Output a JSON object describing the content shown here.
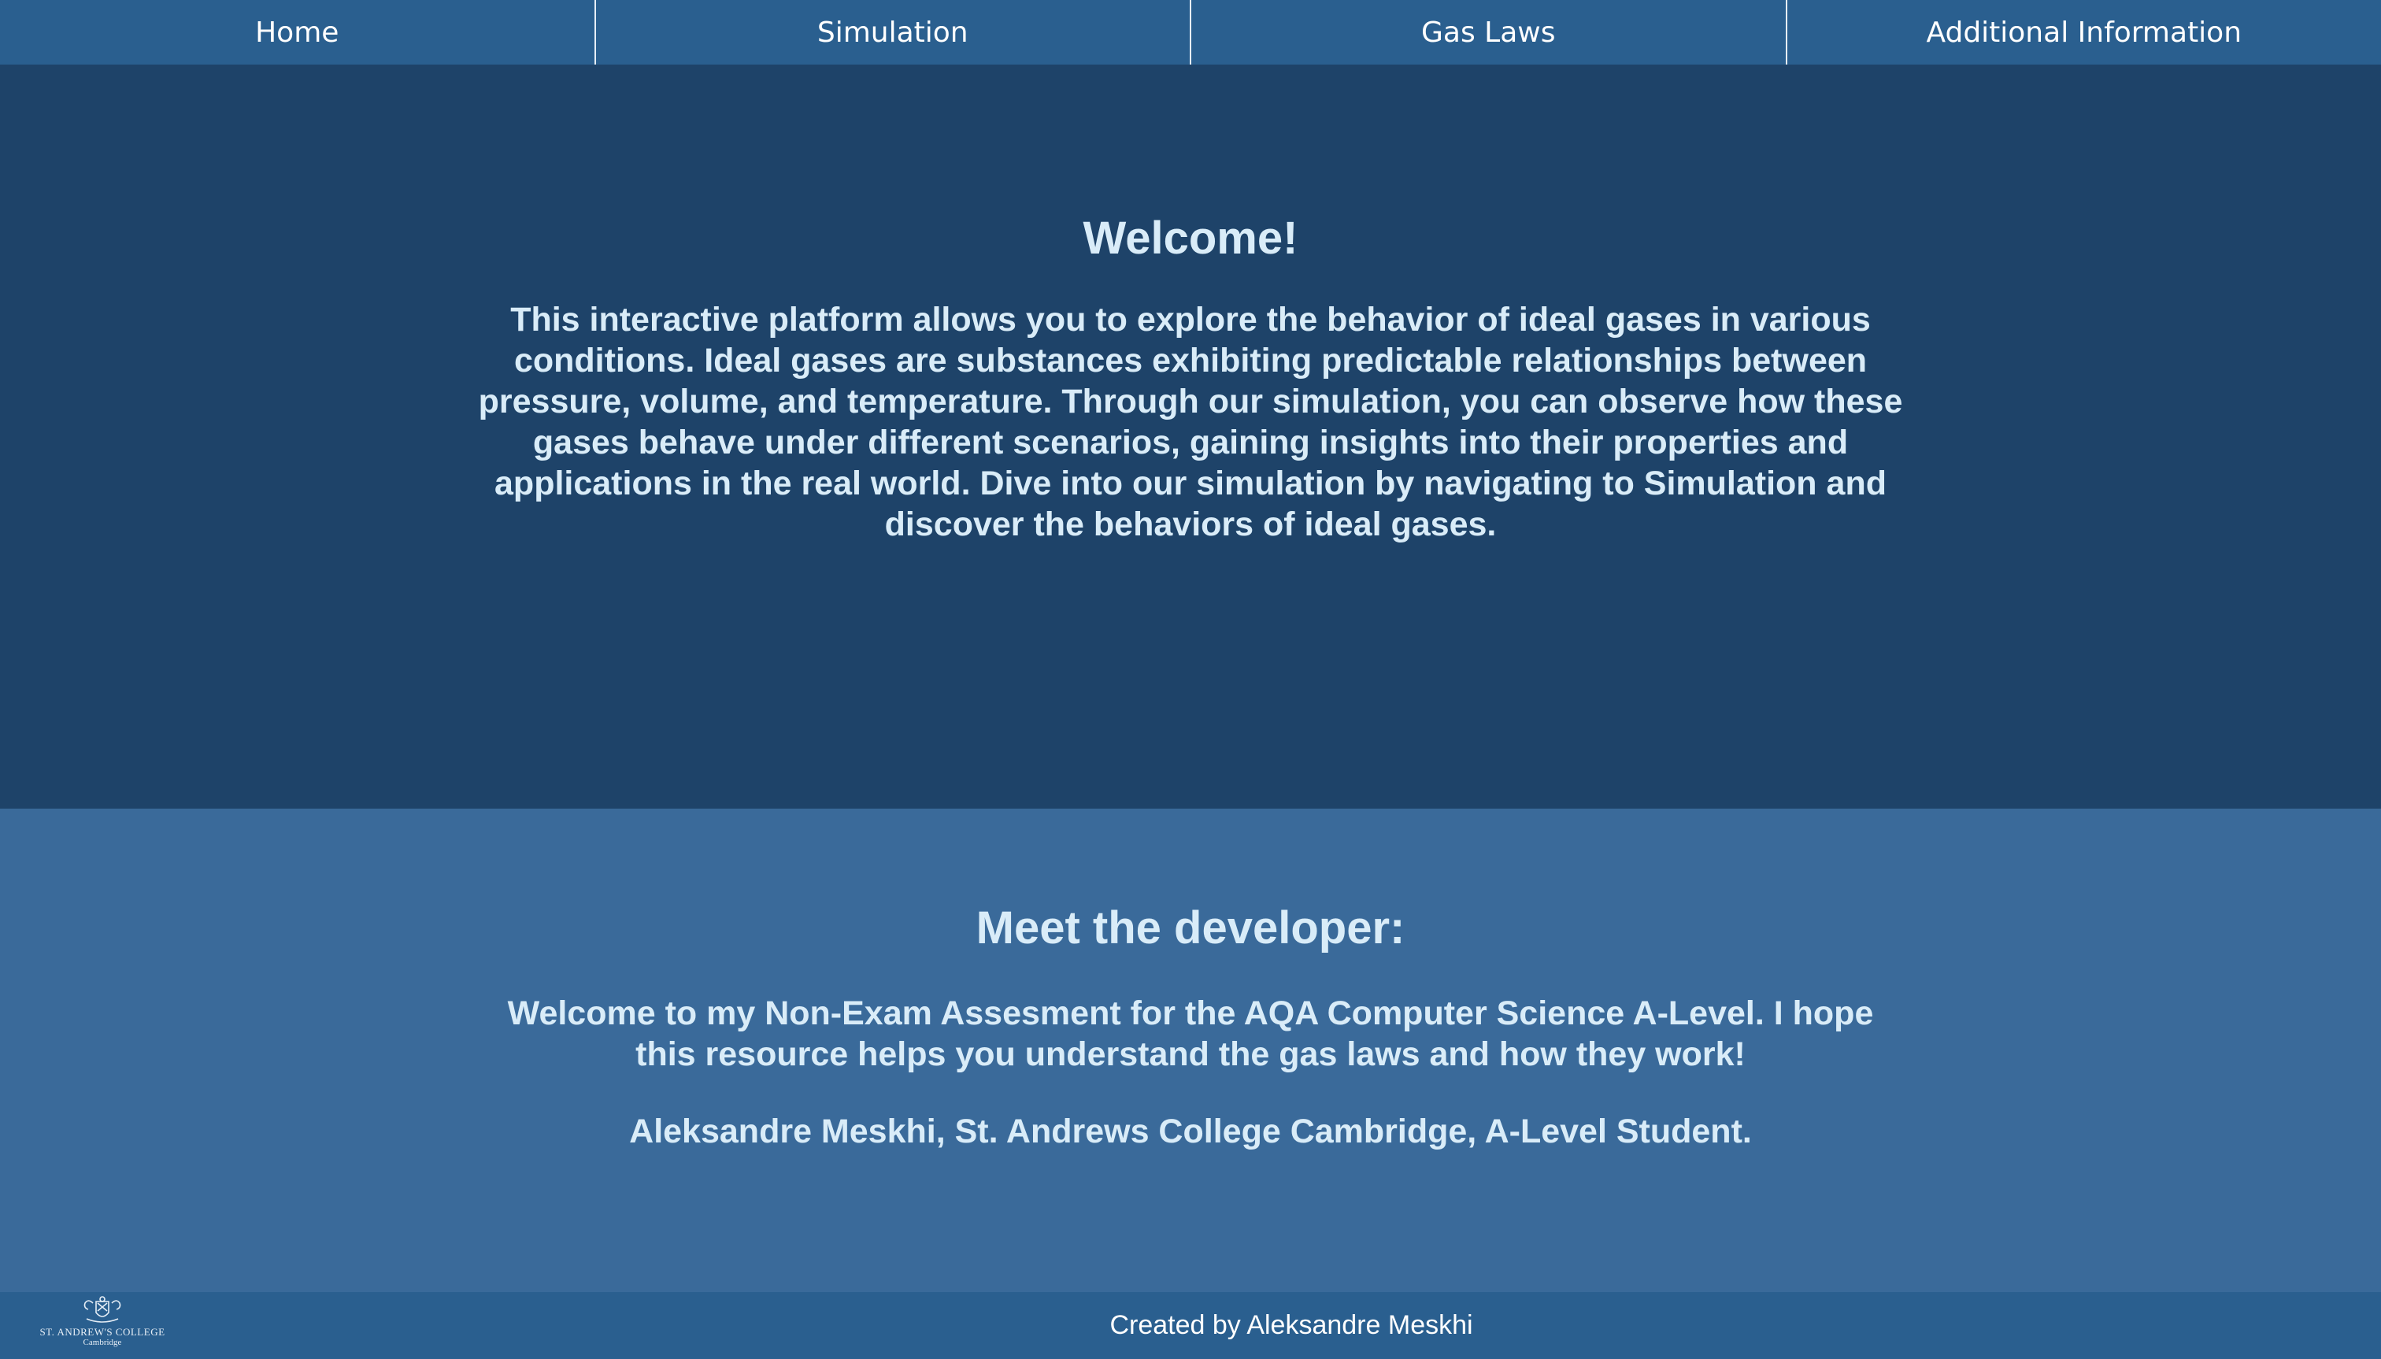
{
  "nav": {
    "items": [
      {
        "label": "Home"
      },
      {
        "label": "Simulation"
      },
      {
        "label": "Gas Laws"
      },
      {
        "label": "Additional Information"
      }
    ]
  },
  "welcome": {
    "title": "Welcome!",
    "text": "This interactive platform allows you to explore the behavior of ideal gases in various conditions. Ideal gases are substances exhibiting predictable relationships between pressure, volume, and temperature. Through our simulation, you can observe how these gases behave under different scenarios, gaining insights into their properties and applications in the real world. Dive into our simulation by navigating to Simulation and discover the behaviors of ideal gases."
  },
  "developer": {
    "title": "Meet the developer:",
    "text": "Welcome to my Non-Exam Assesment for the AQA Computer Science A-Level. I hope this resource helps you understand the gas laws and how they work!",
    "signature": "Aleksandre Meskhi, St. Andrews College Cambridge, A-Level Student."
  },
  "footer": {
    "logo_name": "ST. ANDREW'S COLLEGE",
    "logo_sub": "Cambridge",
    "logo_icon": "college-crest-icon",
    "credit": "Created by Aleksandre Meskhi"
  },
  "colors": {
    "nav_bg": "#2a5f8f",
    "welcome_bg": "#1e4369",
    "developer_bg": "#3a6a9a",
    "footer_bg": "#2a5f8f",
    "heading_text": "#d9ecf8"
  }
}
